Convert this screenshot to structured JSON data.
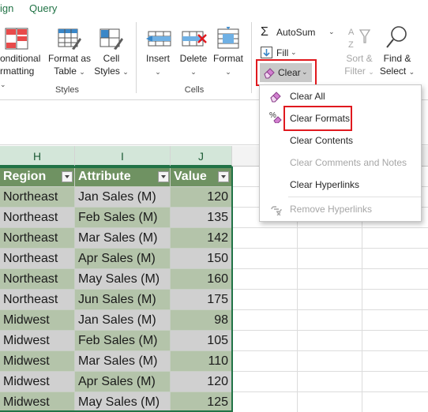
{
  "ribbon_tabs": [
    {
      "label": "ign"
    },
    {
      "label": "Query"
    }
  ],
  "ribbon": {
    "styles": {
      "conditional_line1": "onditional",
      "conditional_line2": "rmatting",
      "format_table_line1": "Format as",
      "format_table_line2": "Table",
      "cell_styles_line1": "Cell",
      "cell_styles_line2": "Styles",
      "group_label": "Styles"
    },
    "cells": {
      "insert": "Insert",
      "delete": "Delete",
      "format": "Format",
      "group_label": "Cells"
    },
    "editing": {
      "autosum": "AutoSum",
      "fill": "Fill",
      "clear": "Clear",
      "sort_filter_line1": "Sort &",
      "sort_filter_line2": "Filter",
      "find_select_line1": "Find &",
      "find_select_line2": "Select"
    }
  },
  "clear_menu": {
    "items": [
      {
        "label": "Clear All",
        "enabled": true,
        "icon": "eraser-icon"
      },
      {
        "label": "Clear Formats",
        "enabled": true,
        "icon": "clear-formats-icon",
        "highlighted": true
      },
      {
        "label": "Clear Contents",
        "enabled": true
      },
      {
        "label": "Clear Comments and Notes",
        "enabled": false
      },
      {
        "label": "Clear Hyperlinks",
        "enabled": true
      },
      {
        "label": "Remove Hyperlinks",
        "enabled": false,
        "icon": "remove-hyperlinks-icon"
      }
    ]
  },
  "columns": [
    "H",
    "I",
    "J"
  ],
  "table": {
    "headers": [
      "Region",
      "Attribute",
      "Value"
    ],
    "rows": [
      [
        "Northeast",
        "Jan Sales (M)",
        "120"
      ],
      [
        "Northeast",
        "Feb Sales (M)",
        "135"
      ],
      [
        "Northeast",
        "Mar Sales (M)",
        "142"
      ],
      [
        "Northeast",
        "Apr Sales (M)",
        "150"
      ],
      [
        "Northeast",
        "May Sales (M)",
        "160"
      ],
      [
        "Northeast",
        "Jun Sales (M)",
        "175"
      ],
      [
        "Midwest",
        "Jan Sales (M)",
        "98"
      ],
      [
        "Midwest",
        "Feb Sales (M)",
        "105"
      ],
      [
        "Midwest",
        "Mar Sales (M)",
        "110"
      ],
      [
        "Midwest",
        "Apr Sales (M)",
        "120"
      ],
      [
        "Midwest",
        "May Sales (M)",
        "125"
      ]
    ]
  },
  "colors": {
    "header_fill": "#6f9262",
    "band_dark": "#b4c4aa",
    "band_light": "#d0d0d0",
    "accent": "#217346",
    "highlight": "#e0191e"
  }
}
